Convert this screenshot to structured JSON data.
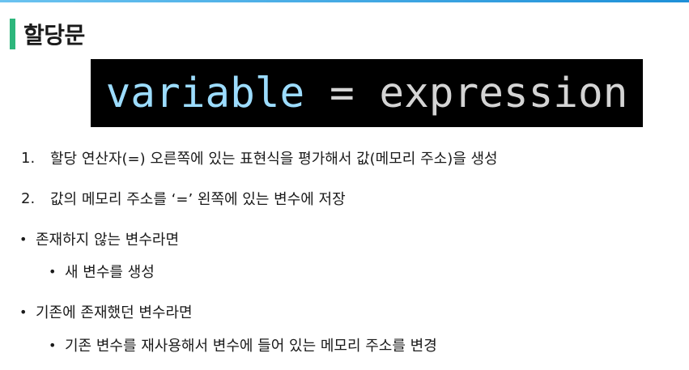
{
  "title": "할당문",
  "code": {
    "variable": "variable",
    "operator": "=",
    "expression": "expression"
  },
  "items": [
    {
      "marker": "1.",
      "text": "할당 연산자(=) 오른쪽에 있는 표현식을 평가해서 값(메모리 주소)을 생성"
    },
    {
      "marker": "2.",
      "text": "값의 메모리 주소를 ‘=’ 왼쪽에 있는 변수에 저장"
    },
    {
      "marker": "•",
      "text": "존재하지 않는 변수라면"
    },
    {
      "marker": "•",
      "text": "새 변수를 생성"
    },
    {
      "marker": "•",
      "text": "기존에 존재했던 변수라면"
    },
    {
      "marker": "•",
      "text": "기존 변수를 재사용해서 변수에 들어 있는 메모리 주소를 변경"
    }
  ],
  "colors": {
    "accent_bar": "#2db67c",
    "top_bar": "#1e90d8",
    "code_background": "#000000",
    "code_variable": "#9cdcfe",
    "code_text": "#d4d4d4"
  }
}
